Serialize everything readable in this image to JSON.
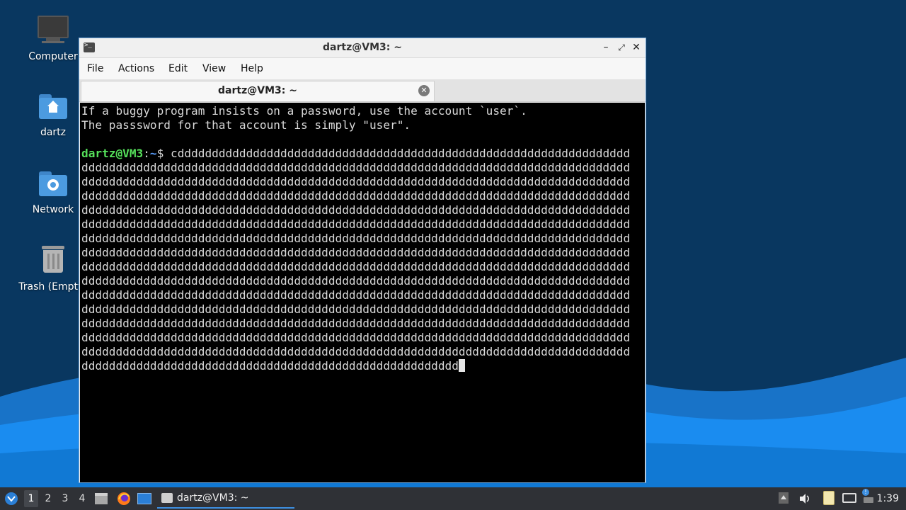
{
  "desktop": {
    "icons": [
      {
        "label": "Computer",
        "icon": "computer-icon"
      },
      {
        "label": "dartz",
        "icon": "home-folder-icon"
      },
      {
        "label": "Network",
        "icon": "network-folder-icon"
      },
      {
        "label": "Trash (Empty)",
        "icon": "trash-icon"
      }
    ]
  },
  "window": {
    "title": "dartz@VM3: ~",
    "menu": [
      "File",
      "Actions",
      "Edit",
      "View",
      "Help"
    ],
    "tab_label": "dartz@VM3: ~"
  },
  "terminal": {
    "motd_line1": "If a buggy program insists on a password, use the account `user`.",
    "motd_line2": "The passsword for that account is simply \"user\".",
    "prompt_user": "dartz@VM3",
    "prompt_sep": ":",
    "prompt_path": "~",
    "prompt_symbol": "$ ",
    "command_text": "cddddddddddddddddddddddddddddddddddddddddddddddddddddddddddddddddddddddddddddddddddddddddddddddddddddddddddddddddddddddddddddddddddddddddddddddddddddddddddddddddddddddddddddddddddddddddddddddddddddddddddddddddddddddddddddddddddddddddddddddddddddddddddddddddddddddddddddddddddddddddddddddddddddddddddddddddddddddddddddddddddddddddddddddddddddddddddddddddddddddddddddddddddddddddddddddddddddddddddddddddddddddddddddddddddddddddddddddddddddddddddddddddddddddddddddddddddddddddddddddddddddddddddddddddddddddddddddddddddddddddddddddddddddddddddddddddddddddddddddddddddddddddddddddddddddddddddddddddddddddddddddddddddddddddddddddddddddddddddddddddddddddddddddddddddddddddddddddddddddddddddddddddddddddddddddddddddddddddddddddddddddddddddddddddddddddddddddddddddddddddddddddddddddddddddddddddddddddddddddddddddddddddddddddddddddddddddddddddddddddddddddddddddddddddddddddddddddddddddddddddddddddddddddddddddddddddddddddddddddddddddddddddddddddddddddddddddddddddddddddddddddddddddddddddddddddddddddddddddddddddddddddddddddddddddddddddddddddddddddddddddddddddddddddddddddddddddddddddddddddddddddddddddddddddddddddddddddddddddddddddddddddddddddddddddddddddddddddddddddddddddddddddddddddddddddddddddddddddddddddddddddddddddddddddddddddddddddddddddddddddd"
  },
  "taskbar": {
    "workspaces": [
      "1",
      "2",
      "3",
      "4"
    ],
    "active_workspace": "1",
    "quicklaunch": [
      "file-manager-icon",
      "firefox-icon",
      "desktop-icon"
    ],
    "task_label": "dartz@VM3: ~",
    "tray": [
      "up-arrow-icon",
      "volume-icon",
      "clipboard-icon",
      "network-icon",
      "update-icon"
    ],
    "clock": "1:39"
  },
  "colors": {
    "desktop_bg": "#0b3a66",
    "wave_light": "#1a8cf0",
    "prompt_user": "#55e05a",
    "prompt_path": "#5aa0ff",
    "taskbar_bg": "#2f3136",
    "accent": "#3d8fe0"
  }
}
